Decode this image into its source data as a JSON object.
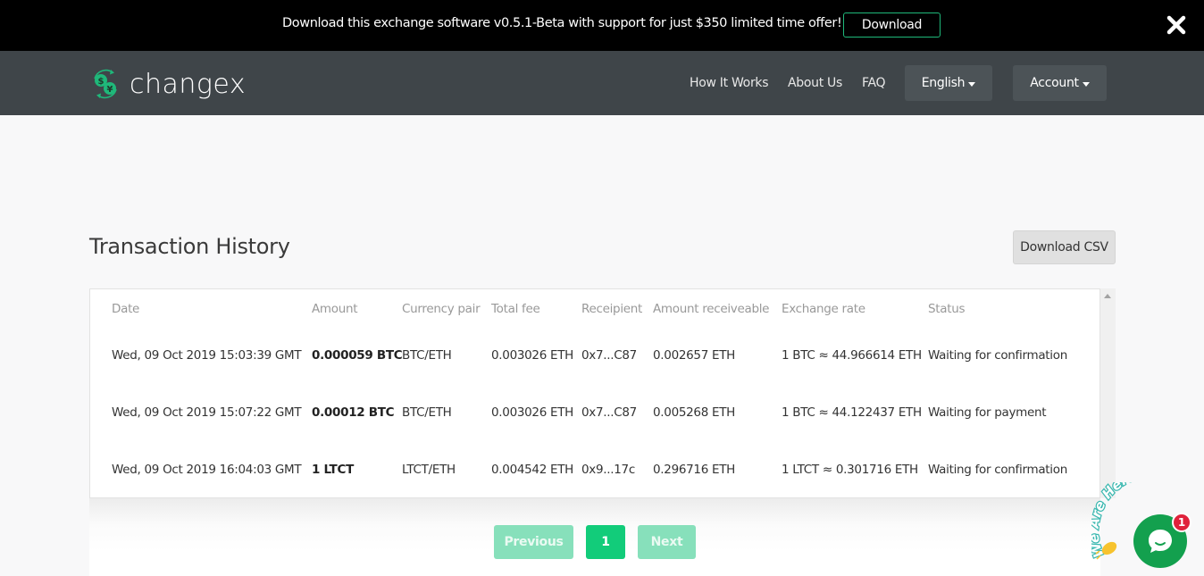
{
  "promo": {
    "text": "Download this exchange software v0.5.1-Beta with support for just $350 limited time offer!",
    "button_label": "Download",
    "close_icon": "close-icon"
  },
  "nav": {
    "brand": "changex",
    "logo_icon": "currency-exchange-icon",
    "links": [
      "How It Works",
      "About Us",
      "FAQ"
    ],
    "language": "English",
    "account": "Account"
  },
  "main": {
    "title": "Transaction History",
    "download_csv_label": "Download CSV",
    "table": {
      "headers": [
        "Date",
        "Amount",
        "Currency pair",
        "Total fee",
        "Receipient",
        "Amount receiveable",
        "Exchange rate",
        "Status"
      ],
      "rows": [
        [
          "Wed, 09 Oct 2019 15:03:39 GMT",
          "0.000059 BTC",
          "BTC/ETH",
          "0.003026 ETH",
          "0x7...C87",
          "0.002657 ETH",
          "1 BTC ≈ 44.966614 ETH",
          "Waiting for confirmation"
        ],
        [
          "Wed, 09 Oct 2019 15:07:22 GMT",
          "0.00012 BTC",
          "BTC/ETH",
          "0.003026 ETH",
          "0x7...C87",
          "0.005268 ETH",
          "1 BTC ≈ 44.122437 ETH",
          "Waiting for payment"
        ],
        [
          "Wed, 09 Oct 2019 16:04:03 GMT",
          "1 LTCT",
          "LTCT/ETH",
          "0.004542 ETH",
          "0x9...17c",
          "0.296716 ETH",
          "1 LTCT ≈ 0.301716 ETH",
          "Waiting for confirmation"
        ]
      ]
    },
    "pagination": {
      "previous": "Previous",
      "current": "1",
      "next": "Next"
    }
  },
  "chat": {
    "banner": "We Are Here!",
    "badge_count": "1",
    "icon": "chat-bubble-icon"
  },
  "colors": {
    "accent": "#12cc7a",
    "accent_disabled": "#87e0bb",
    "nav_bg": "#3f4549",
    "promo_bg": "#000000",
    "chat": "#13a04e",
    "badge": "#e0223b"
  }
}
